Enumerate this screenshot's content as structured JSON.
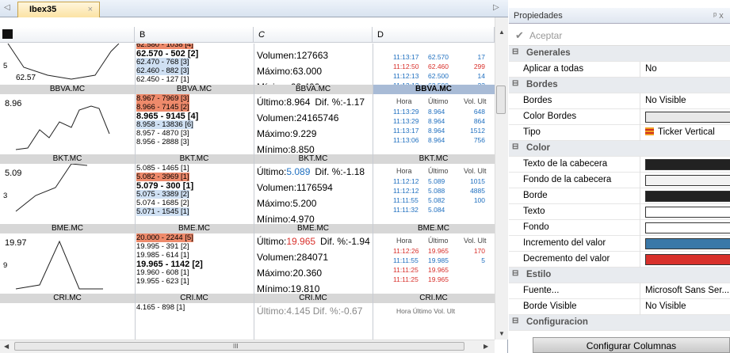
{
  "tab": {
    "title": "Ibex35",
    "close": "×",
    "left_arrow": "◁",
    "right_arrow": "▷"
  },
  "columns": [
    "A",
    "B",
    "C",
    "D"
  ],
  "scroll": {
    "h_label": "III"
  },
  "rows": [
    {
      "label": "BBVA.MC",
      "last": "62.57",
      "side": "5",
      "book": [
        {
          "t": "62.580 - 1038 [4]",
          "hl": "hlr"
        },
        {
          "t": "62.570 - 502 [2]",
          "bold": true
        },
        {
          "t": "62.470 - 768 [3]",
          "hl": "hlbl"
        },
        {
          "t": "62.460 - 882 [3]",
          "hl": "hlbl"
        },
        {
          "t": "62.450 - 127 [1]"
        }
      ],
      "stats": {
        "ultimo": "",
        "dif": "",
        "volumen": "Volumen:127663",
        "maximo": "Máximo:63.000",
        "minimo": "Mínimo:62.400"
      },
      "ticker_head": null,
      "ticks": [
        {
          "h": "11:13:17",
          "p": "62.570",
          "v": "17",
          "c": "blue"
        },
        {
          "h": "11:12:50",
          "p": "62.460",
          "v": "299",
          "c": "red"
        },
        {
          "h": "11:12:13",
          "p": "62.500",
          "v": "14",
          "c": "blue"
        },
        {
          "h": "11:12:13",
          "p": "62.500",
          "v": "23",
          "c": "blue"
        }
      ]
    },
    {
      "label": "BKT.MC",
      "last": "8.96",
      "side": "",
      "book": [
        {
          "t": "8.967 - 7969 [3]",
          "hl": "hlr"
        },
        {
          "t": "8.966 - 7145 [2]",
          "hl": "hlr"
        },
        {
          "t": "8.965 - 9145 [4]",
          "bold": true
        },
        {
          "t": "8.958 - 13836 [6]",
          "hl": "hlbl"
        },
        {
          "t": "8.957 - 4870 [3]"
        },
        {
          "t": "8.956 - 2888 [3]"
        }
      ],
      "stats": {
        "ultimo": "Último:8.964",
        "dif": "Dif. %:-1.17",
        "volumen": "Volumen:24165746",
        "maximo": "Máximo:9.229",
        "minimo": "Mínimo:8.850"
      },
      "ticker_head": "BBVA.MC",
      "ticks": [
        {
          "h": "11:13:29",
          "p": "8.964",
          "v": "648",
          "c": "blue"
        },
        {
          "h": "11:13:29",
          "p": "8.964",
          "v": "864",
          "c": "blue"
        },
        {
          "h": "11:13:17",
          "p": "8.964",
          "v": "1512",
          "c": "blue"
        },
        {
          "h": "11:13:06",
          "p": "8.964",
          "v": "756",
          "c": "blue"
        }
      ]
    },
    {
      "label": "BME.MC",
      "last": "5.09",
      "side": "3",
      "book": [
        {
          "t": "5.085 - 1465 [1]"
        },
        {
          "t": "5.082 - 3969 [1]",
          "hl": "hlr"
        },
        {
          "t": "5.079 - 300 [1]",
          "bold": true
        },
        {
          "t": "5.075 - 3389 [2]",
          "hl": "hlbl"
        },
        {
          "t": "5.074 - 1685 [2]"
        },
        {
          "t": "5.071 - 1545 [1]",
          "hl": "hlbl"
        }
      ],
      "stats": {
        "ultimo": "Último:",
        "ultimo_val": "5.089",
        "dif": "Dif. %:-1.18",
        "volumen": "Volumen:1176594",
        "maximo": "Máximo:5.200",
        "minimo": "Mínimo:4.970"
      },
      "ticker_head": "BKT.MC",
      "ticks": [
        {
          "h": "11:12:12",
          "p": "5.089",
          "v": "1015",
          "c": "blue"
        },
        {
          "h": "11:12:12",
          "p": "5.088",
          "v": "4885",
          "c": "blue"
        },
        {
          "h": "11:11:55",
          "p": "5.082",
          "v": "100",
          "c": "blue"
        },
        {
          "h": "11:11:32",
          "p": "5.084",
          "v": "",
          "c": "blue"
        }
      ]
    },
    {
      "label": "CRI.MC",
      "last": "19.97",
      "side": "9",
      "book": [
        {
          "t": "20.000 - 2244 [5]",
          "hl": "hlr"
        },
        {
          "t": "19.995 - 391 [2]"
        },
        {
          "t": "19.985 - 614 [1]"
        },
        {
          "t": "19.965 - 1142 [2]",
          "bold": true
        },
        {
          "t": "19.960 - 608 [1]"
        },
        {
          "t": "19.955 - 623 [1]"
        }
      ],
      "stats": {
        "ultimo": "Último:",
        "ultimo_val": "19.965",
        "dif": "Dif. %:-1.94",
        "volumen": "Volumen:284071",
        "maximo": "Máximo:20.360",
        "minimo": "Mínimo:19.810"
      },
      "ticker_head": "BME.MC",
      "ticks": [
        {
          "h": "11:12:26",
          "p": "19.965",
          "v": "170",
          "c": "red"
        },
        {
          "h": "11:11:55",
          "p": "19.985",
          "v": "5",
          "c": "blue"
        },
        {
          "h": "11:11:25",
          "p": "19.965",
          "v": "",
          "c": "red"
        },
        {
          "h": "11:11:25",
          "p": "19.965",
          "v": "",
          "c": "red"
        }
      ]
    }
  ],
  "row5": {
    "label": "CRI.MC",
    "book0": "4.165 - 898 [1]",
    "stat0": "Último:4.145  Dif. %:-0.67",
    "tick0": "Hora  Último  Vol. Ult"
  },
  "ticker_cols": {
    "hora": "Hora",
    "ultimo": "Último",
    "vol": "Vol. Ult"
  },
  "props": {
    "title": "Propiedades",
    "pin": "ᵖ x",
    "accept": "Aceptar",
    "sections": [
      {
        "name": "Generales",
        "items": [
          {
            "label": "Aplicar a todas",
            "value": "No"
          }
        ]
      },
      {
        "name": "Bordes",
        "items": [
          {
            "label": "Bordes",
            "value": "No Visible"
          },
          {
            "label": "Color Bordes",
            "swatch": "#e8e8e8"
          },
          {
            "label": "Tipo",
            "value": "Ticker Vertical",
            "icon": true
          }
        ]
      },
      {
        "name": "Color",
        "items": [
          {
            "label": "Texto de la cabecera",
            "swatch": "#222222"
          },
          {
            "label": "Fondo de la cabecera",
            "swatch": "#f2f2f2"
          },
          {
            "label": "Borde",
            "swatch": "#222222"
          },
          {
            "label": "Texto",
            "swatch": "#ffffff"
          },
          {
            "label": "Fondo",
            "swatch": "#ffffff"
          },
          {
            "label": "Incremento del valor",
            "swatch": "#3a78a8"
          },
          {
            "label": "Decremento del valor",
            "swatch": "#d8302b"
          }
        ]
      },
      {
        "name": "Estilo",
        "items": [
          {
            "label": "Fuente...",
            "value": "Microsoft Sans Ser..."
          },
          {
            "label": "Borde Visible",
            "value": "No Visible"
          }
        ]
      },
      {
        "name": "Configuracion",
        "items": []
      }
    ],
    "config_button": "Configurar Columnas"
  }
}
